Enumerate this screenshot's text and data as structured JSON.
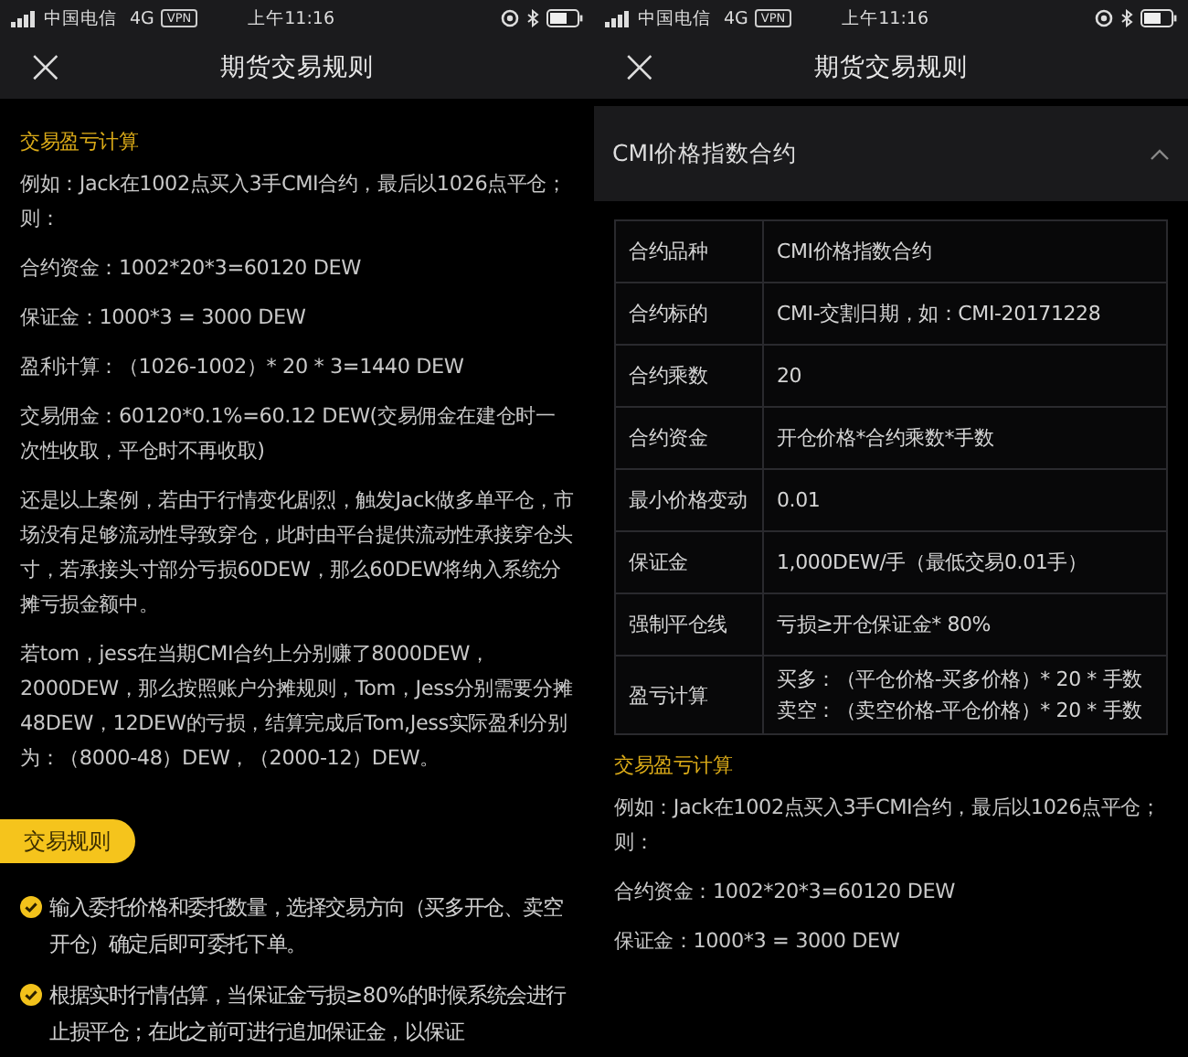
{
  "screens": [
    {
      "status_bar": {
        "carrier": "中国电信",
        "network": "4G",
        "vpn": "VPN",
        "time": "上午11:16"
      },
      "nav": {
        "close": "×",
        "title": "期货交易规则"
      },
      "blocks": [
        {
          "kind": "heading",
          "text": "交易盈亏计算"
        },
        {
          "kind": "paragraph",
          "text": "例如：Jack在1002点买入3手CMI合约，最后以1026点平仓；则："
        },
        {
          "kind": "paragraph",
          "text": "合约资金：1002*20*3=60120 DEW"
        },
        {
          "kind": "paragraph",
          "text": "保证金：1000*3 = 3000 DEW"
        },
        {
          "kind": "paragraph",
          "text": "盈利计算：（1026-1002）* 20 * 3=1440 DEW"
        },
        {
          "kind": "paragraph",
          "text": "交易佣金：60120*0.1%=60.12 DEW(交易佣金在建仓时一次性收取，平仓时不再收取)"
        },
        {
          "kind": "paragraph",
          "text": "还是以上案例，若由于行情变化剧烈，触发Jack做多单平仓，市场没有足够流动性导致穿仓，此时由平台提供流动性承接穿仓头寸，若承接头寸部分亏损60DEW，那么60DEW将纳入系统分摊亏损金额中。"
        },
        {
          "kind": "paragraph",
          "text": "若tom，jess在当期CMI合约上分别赚了8000DEW，2000DEW，那么按照账户分摊规则，Tom，Jess分别需要分摊48DEW，12DEW的亏损，结算完成后Tom,Jess实际盈利分别为：（8000-48）DEW，（2000-12）DEW。"
        },
        {
          "kind": "badge",
          "text": "交易规则"
        },
        {
          "kind": "bullet",
          "text": "输入委托价格和委托数量，选择交易方向（买多开仓、卖空开仓）确定后即可委托下单。"
        },
        {
          "kind": "bullet",
          "text": "根据实时行情估算，当保证金亏损≥80%的时候系统会进行止损平仓；在此之前可进行追加保证金，以保证"
        }
      ]
    },
    {
      "status_bar": {
        "carrier": "中国电信",
        "network": "4G",
        "vpn": "VPN",
        "time": "上午11:16"
      },
      "nav": {
        "close": "×",
        "title": "期货交易规则"
      },
      "accordion": {
        "title": "CMI价格指数合约",
        "expanded": true
      },
      "table": [
        {
          "label": "合约品种",
          "value": [
            "CMI价格指数合约"
          ]
        },
        {
          "label": "合约标的",
          "value": [
            "CMI-交割日期，如：CMI-20171228"
          ]
        },
        {
          "label": "合约乘数",
          "value": [
            "20"
          ]
        },
        {
          "label": "合约资金",
          "value": [
            "开仓价格*合约乘数*手数"
          ]
        },
        {
          "label": "最小价格变动",
          "value": [
            "0.01"
          ]
        },
        {
          "label": "保证金",
          "value": [
            "1,000DEW/手（最低交易0.01手）"
          ]
        },
        {
          "label": "强制平仓线",
          "value": [
            "亏损≥开仓保证金* 80%"
          ]
        },
        {
          "label": "盈亏计算",
          "value": [
            "买多：（平仓价格-买多价格）* 20 * 手数",
            "卖空：（卖空价格-平仓价格）* 20 * 手数"
          ]
        }
      ],
      "blocks": [
        {
          "kind": "heading",
          "text": "交易盈亏计算"
        },
        {
          "kind": "paragraph",
          "text": "例如：Jack在1002点买入3手CMI合约，最后以1026点平仓；则："
        },
        {
          "kind": "paragraph",
          "text": "合约资金：1002*20*3=60120 DEW"
        },
        {
          "kind": "paragraph",
          "text": "保证金：1000*3 = 3000 DEW"
        }
      ]
    }
  ]
}
